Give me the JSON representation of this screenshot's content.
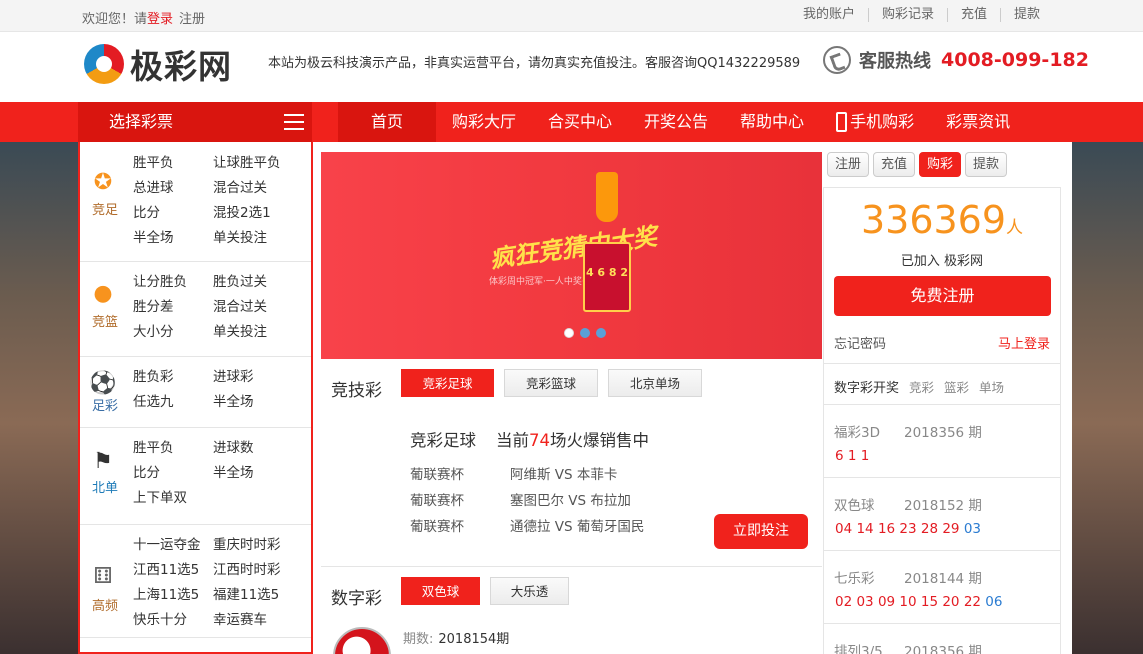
{
  "topbar": {
    "welcome": "欢迎您！请",
    "login": "登录",
    "register": "注册",
    "links": [
      "我的账户",
      "购彩记录",
      "充值",
      "提款"
    ]
  },
  "header": {
    "logo_text": "极彩网",
    "notice": "本站为极云科技演示产品，非真实运营平台，请勿真实充值投注。客服咨询QQ1432229589",
    "hotline_label": "客服热线",
    "hotline_number": "4008-099-182"
  },
  "nav": {
    "select_label": "选择彩票",
    "items": [
      "首页",
      "购彩大厅",
      "合买中心",
      "开奖公告",
      "帮助中心",
      "手机购彩",
      "彩票资讯"
    ]
  },
  "categories": [
    {
      "name": "竞足",
      "icon": "football-icon",
      "games": [
        "胜平负",
        "让球胜平负",
        "总进球",
        "混合过关",
        "比分",
        "混投2选1",
        "半全场",
        "单关投注"
      ]
    },
    {
      "name": "竞篮",
      "icon": "basketball-icon",
      "games": [
        "让分胜负",
        "胜负过关",
        "胜分差",
        "混合过关",
        "大小分",
        "单关投注"
      ]
    },
    {
      "name": "足彩",
      "icon": "soccer-lottery-icon",
      "games": [
        "胜负彩",
        "进球彩",
        "任选九",
        "半全场"
      ]
    },
    {
      "name": "北单",
      "icon": "beidan-icon",
      "games": [
        "胜平负",
        "进球数",
        "比分",
        "半全场",
        "上下单双"
      ]
    },
    {
      "name": "高频",
      "icon": "dice-icon",
      "games": [
        "十一运夺金",
        "重庆时时彩",
        "江西11选5",
        "江西时时彩",
        "上海11选5",
        "福建11选5",
        "快乐十分",
        "幸运赛车"
      ]
    }
  ],
  "banner": {
    "slogan": "疯狂竞猜中大奖",
    "sub": "体彩周中冠军·一人中奖·快乐分享",
    "numbers": "4 6 8 2"
  },
  "jingji": {
    "title": "竞技彩",
    "tabs": [
      "竞彩足球",
      "竞彩篮球",
      "北京单场"
    ],
    "head_name": "竞彩足球",
    "hot_pre": "当前",
    "hot_count": "74",
    "hot_post": "场火爆销售中",
    "matches": [
      {
        "league": "葡联赛杯",
        "teams": "阿维斯 VS 本菲卡"
      },
      {
        "league": "葡联赛杯",
        "teams": "塞图巴尔 VS 布拉加"
      },
      {
        "league": "葡联赛杯",
        "teams": "通德拉 VS 葡萄牙国民"
      }
    ],
    "bet_button": "立即投注"
  },
  "shuzi": {
    "title": "数字彩",
    "tabs": [
      "双色球",
      "大乐透"
    ],
    "issue_label": "期数:",
    "issue": "2018154期"
  },
  "right": {
    "tabs": [
      "注册",
      "充值",
      "购彩",
      "提款"
    ],
    "count": "336369",
    "count_unit": "人",
    "joined": "已加入 极彩网",
    "register_button": "免费注册",
    "forgot": "忘记密码",
    "login_now": "马上登录",
    "draw_head": "数字彩开奖",
    "draw_tabs": [
      "竞彩",
      "篮彩",
      "单场"
    ],
    "draws": [
      {
        "name": "福彩3D",
        "period": "2018356 期",
        "red": "6 1 1",
        "blue": ""
      },
      {
        "name": "双色球",
        "period": "2018152 期",
        "red": "04 14 16 23 28 29",
        "blue": "03"
      },
      {
        "name": "七乐彩",
        "period": "2018144 期",
        "red": "02 03 09 10 15 20 22",
        "blue": "06"
      },
      {
        "name": "排列3/5",
        "period": "2018356 期",
        "red": "",
        "blue": ""
      }
    ]
  },
  "colors": {
    "brand_red": "#f0221c",
    "orange": "#f7931e",
    "blue_ball": "#2a7bd1"
  }
}
